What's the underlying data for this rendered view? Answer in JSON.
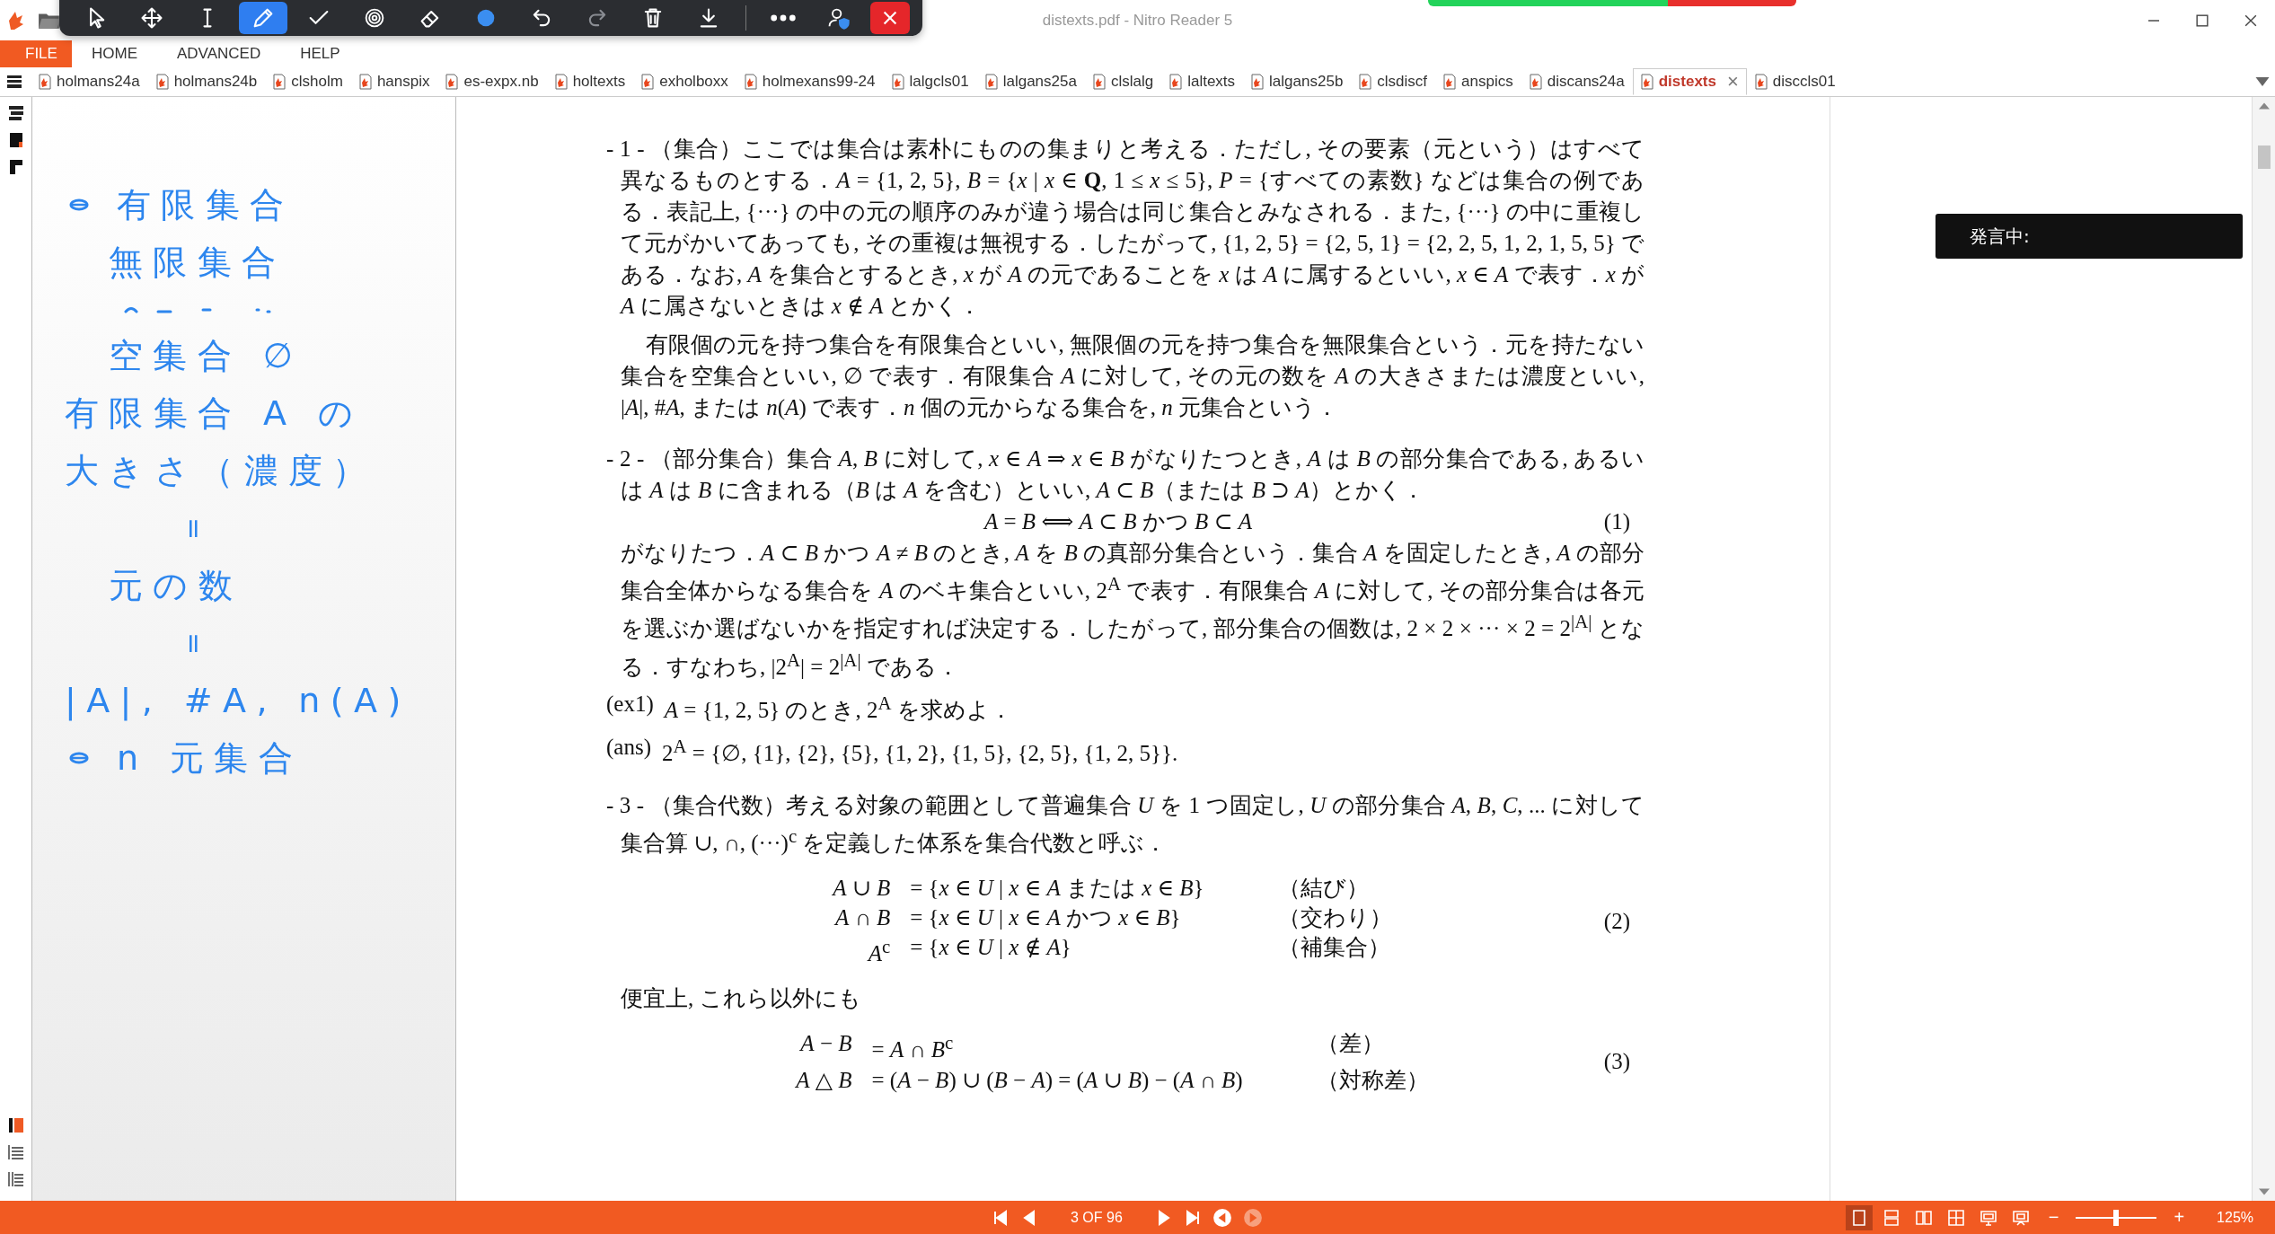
{
  "window": {
    "title": "distexts.pdf - Nitro Reader 5"
  },
  "toolbar": {
    "tools": [
      {
        "kind": "pointer",
        "selected": false
      },
      {
        "kind": "move",
        "selected": false
      },
      {
        "kind": "text",
        "selected": false
      },
      {
        "kind": "pen",
        "selected": true
      },
      {
        "kind": "check",
        "selected": false
      },
      {
        "kind": "stamp",
        "selected": false
      },
      {
        "kind": "eraser",
        "selected": false
      },
      {
        "kind": "color",
        "selected": false
      },
      {
        "kind": "undo",
        "selected": false
      },
      {
        "kind": "redo",
        "selected": false
      },
      {
        "kind": "delete",
        "selected": false
      },
      {
        "kind": "download",
        "selected": false
      }
    ],
    "extra": [
      {
        "kind": "more"
      },
      {
        "kind": "share"
      },
      {
        "kind": "close"
      }
    ]
  },
  "menu": [
    {
      "label": "FILE",
      "kind": "backstage"
    },
    {
      "label": "HOME",
      "kind": "ribbon"
    },
    {
      "label": "ADVANCED",
      "kind": "ribbon"
    },
    {
      "label": "HELP",
      "kind": "ribbon"
    }
  ],
  "tabs": [
    {
      "label": "holmans24a",
      "selected": false
    },
    {
      "label": "holmans24b",
      "selected": false
    },
    {
      "label": "clsholm",
      "selected": false
    },
    {
      "label": "hanspix",
      "selected": false
    },
    {
      "label": "es-expx.nb",
      "selected": false
    },
    {
      "label": "holtexts",
      "selected": false
    },
    {
      "label": "exholboxx",
      "selected": false
    },
    {
      "label": "holmexans99-24",
      "selected": false
    },
    {
      "label": "lalgcls01",
      "selected": false
    },
    {
      "label": "lalgans25a",
      "selected": false
    },
    {
      "label": "clslalg",
      "selected": false
    },
    {
      "label": "laltexts",
      "selected": false
    },
    {
      "label": "lalgans25b",
      "selected": false
    },
    {
      "label": "clsdiscf",
      "selected": false
    },
    {
      "label": "anspics",
      "selected": false
    },
    {
      "label": "discans24a",
      "selected": false
    },
    {
      "label": "distexts",
      "selected": true,
      "close": "×"
    },
    {
      "label": "disccls01",
      "selected": false
    }
  ],
  "notes": [
    {
      "kind": "bullet",
      "text": "有限集合"
    },
    {
      "kind": "indent",
      "text": "無限集合"
    },
    {
      "kind": "scribble"
    },
    {
      "kind": "indent",
      "text": "空集合  ∅"
    },
    {
      "kind": "plain",
      "text": "有限集合  A の"
    },
    {
      "kind": "plain",
      "text": "大きさ（濃度）"
    },
    {
      "kind": "mark",
      "text": "="
    },
    {
      "kind": "indent",
      "text": "元の数"
    },
    {
      "kind": "mark",
      "text": "="
    },
    {
      "kind": "plain",
      "text": "|A|, #A, n(A)"
    },
    {
      "kind": "bullet",
      "text": "n 元集合"
    }
  ],
  "document": {
    "blocks": [
      {
        "kind": "item",
        "text": "- 1 - （集合）ここでは集合は素朴にものの集まりと考える．ただし, その要素（元という）はすべて異なるものとする．*A* = {1, 2, 5}, *B* = {*x* | *x* ∈ **Q**, 1 ≤ *x* ≤ 5}, *P* = {すべての素数} などは集合の例である．表記上, {···} の中の元の順序のみが違う場合は同じ集合とみなされる．また, {···} の中に重複して元がかいてあっても, その重複は無視する．したがって, {1, 2, 5} = {2, 5, 1} = {2, 2, 5, 1, 2, 1, 5, 5} である．なお, *A* を集合とするとき, *x* が *A* の元であることを *x* は *A* に属するといい, *x* ∈ *A* で表す．*x* が *A* に属さないときは *x* ∉ *A* とかく．"
      },
      {
        "kind": "para",
        "text": "有限個の元を持つ集合を有限集合といい, 無限個の元を持つ集合を無限集合という．元を持たない集合を空集合といい, ∅ で表す．有限集合 *A* に対して, その元の数を *A* の大きさまたは濃度といい, |*A*|, #*A*, または *n*(*A*) で表す．*n* 個の元からなる集合を, *n* 元集合という．"
      },
      {
        "kind": "item",
        "text": "- 2 - （部分集合）集合 *A*, *B* に対して, *x* ∈ *A* ⇒ *x* ∈ *B* がなりたつとき, *A* は *B* の部分集合である, あるいは *A* は *B* に含まれる（*B* は *A* を含む）といい, *A* ⊂ *B*（または *B* ⊃ *A*）とかく．"
      },
      {
        "kind": "equation",
        "text": "*A* = *B*  ⟺  *A* ⊂ *B* かつ *B* ⊂ *A*",
        "number": "(1)"
      },
      {
        "kind": "cont",
        "text": "がなりたつ．*A* ⊂ *B* かつ *A* ≠ *B* のとき, *A* を *B* の真部分集合という．集合 *A* を固定したとき, *A* の部分集合全体からなる集合を *A* のベキ集合といい, 2$^{A}$ で表す．有限集合 *A* に対して, その部分集合は各元を選ぶか選ばないかを指定すれば決定する．したがって, 部分集合の個数は, 2 × 2 × ··· × 2 = 2$^{|A|}$ となる．すなわち, |2$^{A}$| = 2$^{|A|}$ である．"
      },
      {
        "kind": "labeled",
        "label": "(ex1)",
        "text": "*A* = {1, 2, 5} のとき, 2$^{A}$ を求めよ．"
      },
      {
        "kind": "labeled",
        "label": "(ans)",
        "text": "2$^{A}$ = {∅, {1}, {2}, {5}, {1, 2}, {1, 5}, {2, 5}, {1, 2, 5}}."
      },
      {
        "kind": "item",
        "text": "- 3 - （集合代数）考える対象の範囲として普遍集合 *U* を 1 つ固定し, *U* の部分集合 *A*, *B*, *C*, ... に対して集合算 ∪, ∩, (···)$^{c}$ を定義した体系を集合代数と呼ぶ．"
      },
      {
        "kind": "align",
        "number": "(2)",
        "rows": [
          {
            "lhs": "*A* ∪ *B*",
            "rhs": "= {*x* ∈ *U* | *x* ∈ *A* または *x* ∈ *B*}",
            "note": "（結び）"
          },
          {
            "lhs": "*A* ∩ *B*",
            "rhs": "= {*x* ∈ *U* | *x* ∈ *A* かつ *x* ∈ *B*}",
            "note": "（交わり）"
          },
          {
            "lhs": "*A*$^{c}$",
            "rhs": "= {*x* ∈ *U* | *x* ∉ *A*}",
            "note": "（補集合）"
          }
        ]
      },
      {
        "kind": "cont",
        "text": "便宜上, これら以外にも"
      },
      {
        "kind": "align",
        "number": "(3)",
        "rows": [
          {
            "lhs": "*A* − *B*",
            "rhs": "= *A* ∩ *B*$^{c}$",
            "note": "（差）"
          },
          {
            "lhs": "*A* △ *B*",
            "rhs": "= (*A* − *B*) ∪ (*B* − *A*) = (*A* ∪ *B*) − (*A* ∩ *B*)",
            "note": "（対称差）"
          }
        ]
      }
    ]
  },
  "speech": {
    "label": "発言中:"
  },
  "status": {
    "nav": [
      {
        "kind": "first",
        "disabled": false
      },
      {
        "kind": "prev",
        "disabled": false
      }
    ],
    "page": "3 OF 96",
    "nav2": [
      {
        "kind": "next",
        "disabled": false
      },
      {
        "kind": "last",
        "disabled": false
      },
      {
        "kind": "back",
        "disabled": false
      },
      {
        "kind": "forward",
        "disabled": true
      }
    ],
    "views": [
      {
        "kind": "single",
        "selected": true
      },
      {
        "kind": "stacked",
        "selected": false
      },
      {
        "kind": "columns",
        "selected": false
      },
      {
        "kind": "grid",
        "selected": false
      },
      {
        "kind": "screen",
        "selected": false
      },
      {
        "kind": "present",
        "selected": false
      }
    ],
    "zoom_out": "−",
    "zoom": {
      "level": 0.5
    },
    "zoom_in": "+",
    "zoom_value": "125%"
  }
}
